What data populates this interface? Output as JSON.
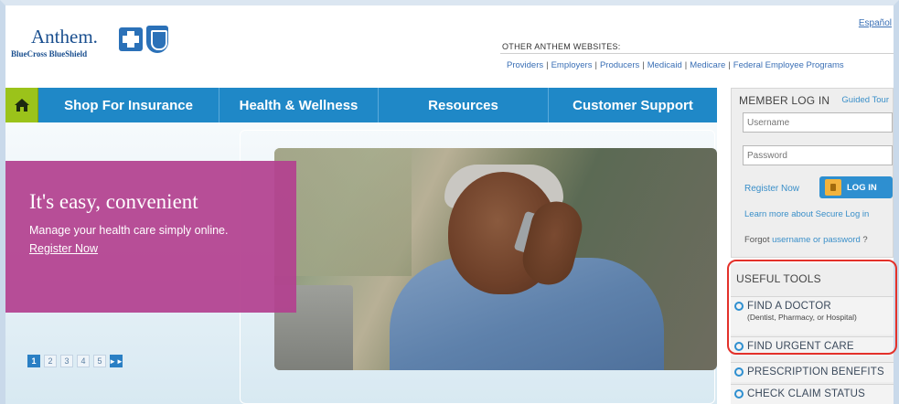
{
  "brand": {
    "name": "Anthem.",
    "sub": "BlueCross BlueShield",
    "colors": {
      "primary": "#1f88c7",
      "home": "#9bc31a",
      "promo": "#b3418f",
      "highlight": "#e3312a"
    }
  },
  "header": {
    "language_link": "Español",
    "other_sites_label": "OTHER ANTHEM WEBSITES:",
    "other_sites": [
      "Providers",
      "Employers",
      "Producers",
      "Medicaid",
      "Medicare",
      "Federal Employee Programs"
    ]
  },
  "nav": {
    "home_icon": "home-icon",
    "items": [
      "Shop For Insurance",
      "Health & Wellness",
      "Resources",
      "Customer Support"
    ]
  },
  "hero": {
    "title": "It's easy, convenient",
    "text": "Manage your health care simply online.",
    "link": "Register Now",
    "pages": [
      "1",
      "2",
      "3",
      "4",
      "5"
    ],
    "active_page": 1
  },
  "login": {
    "title": "MEMBER LOG IN",
    "guided_tour": "Guided Tour",
    "username_placeholder": "Username",
    "password_placeholder": "Password",
    "register": "Register Now",
    "button": "LOG IN",
    "learn_more": "Learn more about Secure Log in",
    "forgot_prefix": "Forgot",
    "forgot_link": "username or password",
    "forgot_suffix": "?"
  },
  "tools": {
    "title": "USEFUL TOOLS",
    "items": [
      {
        "label": "FIND A DOCTOR",
        "sub": "(Dentist, Pharmacy, or Hospital)"
      },
      {
        "label": "FIND URGENT CARE"
      },
      {
        "label": "PRESCRIPTION BENEFITS"
      },
      {
        "label": "CHECK CLAIM STATUS"
      }
    ]
  }
}
